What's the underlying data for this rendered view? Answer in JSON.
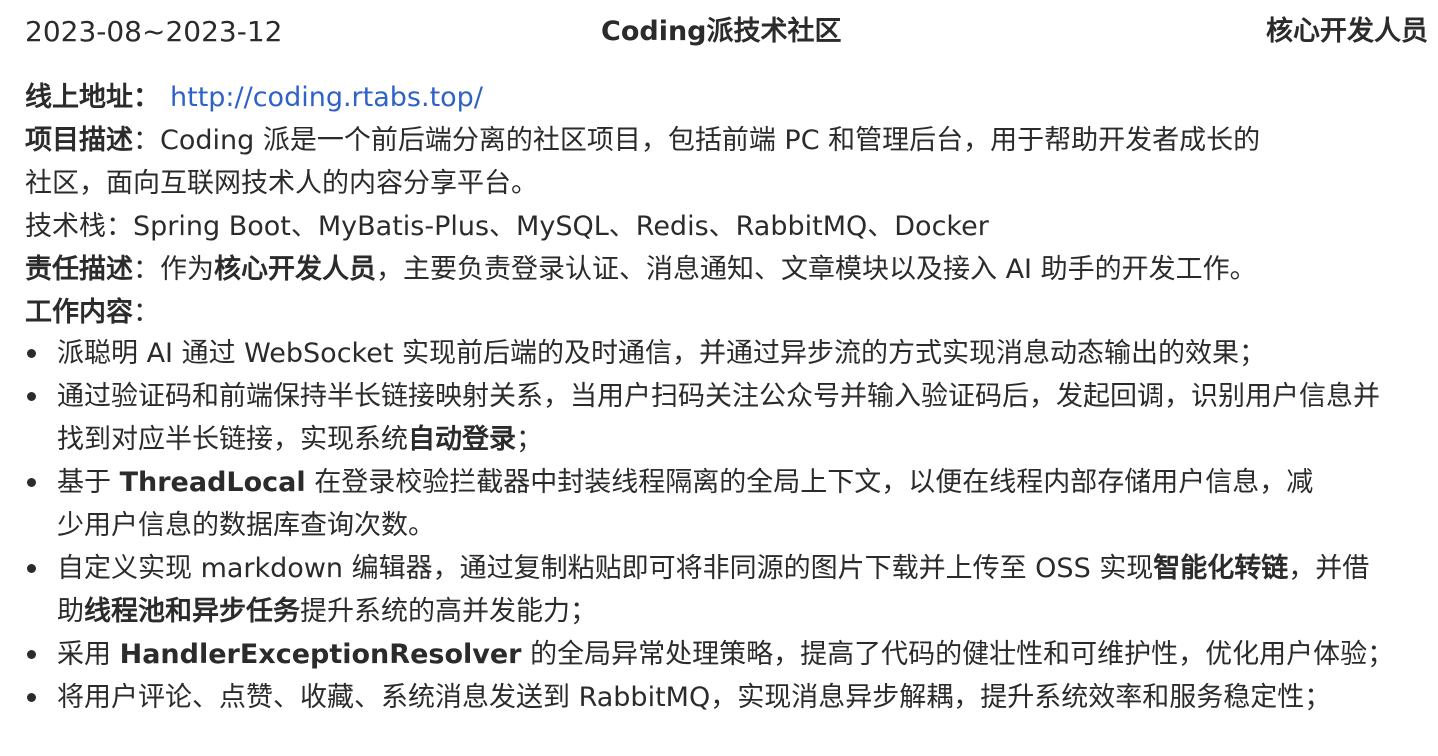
{
  "header": {
    "date": "2023-08~2023-12",
    "project_title": "Coding派技术社区",
    "role": "核心开发人员"
  },
  "info": {
    "url_label": "线上地址：",
    "url": "http://coding.rtabs.top/",
    "desc_label": "项目描述",
    "desc_line1": "：Coding 派是一个前后端分离的社区项目，包括前端 PC 和管理后台，用于帮助开发者成长的",
    "desc_line2": "社区，面向互联网技术人的内容分享平台。",
    "stack": "技术栈：Spring Boot、MyBatis-Plus、MySQL、Redis、RabbitMQ、Docker",
    "resp_label": "责任描述",
    "resp_pre": "：作为",
    "resp_bold": "核心开发人员",
    "resp_post": "，主要负责登录认证、消息通知、文章模块以及接入 AI 助手的开发工作。",
    "work_label": "工作内容",
    "work_colon": "："
  },
  "work": {
    "item1_line1": "派聪明 AI 通过 WebSocket 实现前后端的及时通信，并通过异步流的方式实现消息动态输出的效果；",
    "item2_line1": "通过验证码和前端保持半长链接映射关系，当用户扫码关注公众号并输入验证码后，发起回调，识别用户信息并",
    "item2_line2_pre": "找到对应半长链接，实现系统",
    "item2_line2_bold": "自动登录",
    "item2_line2_post": "；",
    "item3_pre": "基于 ",
    "item3_bold": "ThreadLocal",
    "item3_line1_post": " 在登录校验拦截器中封装线程隔离的全局上下文，以便在线程内部存储用户信息，减",
    "item3_line2": "少用户信息的数据库查询次数。",
    "item4_line1_pre": "自定义实现 markdown 编辑器，通过复制粘贴即可将非同源的图片下载并上传至 OSS 实现",
    "item4_line1_bold": "智能化转链",
    "item4_line1_post": "，并借",
    "item4_line2_pre": "助",
    "item4_line2_bold": "线程池和异步任务",
    "item4_line2_post": "提升系统的高并发能力；",
    "item5_pre": "采用 ",
    "item5_bold": "HandlerExceptionResolver",
    "item5_post": " 的全局异常处理策略，提高了代码的健壮性和可维护性，优化用户体验；",
    "item6": "将用户评论、点赞、收藏、系统消息发送到 RabbitMQ，实现消息异步解耦，提升系统效率和服务稳定性；"
  }
}
